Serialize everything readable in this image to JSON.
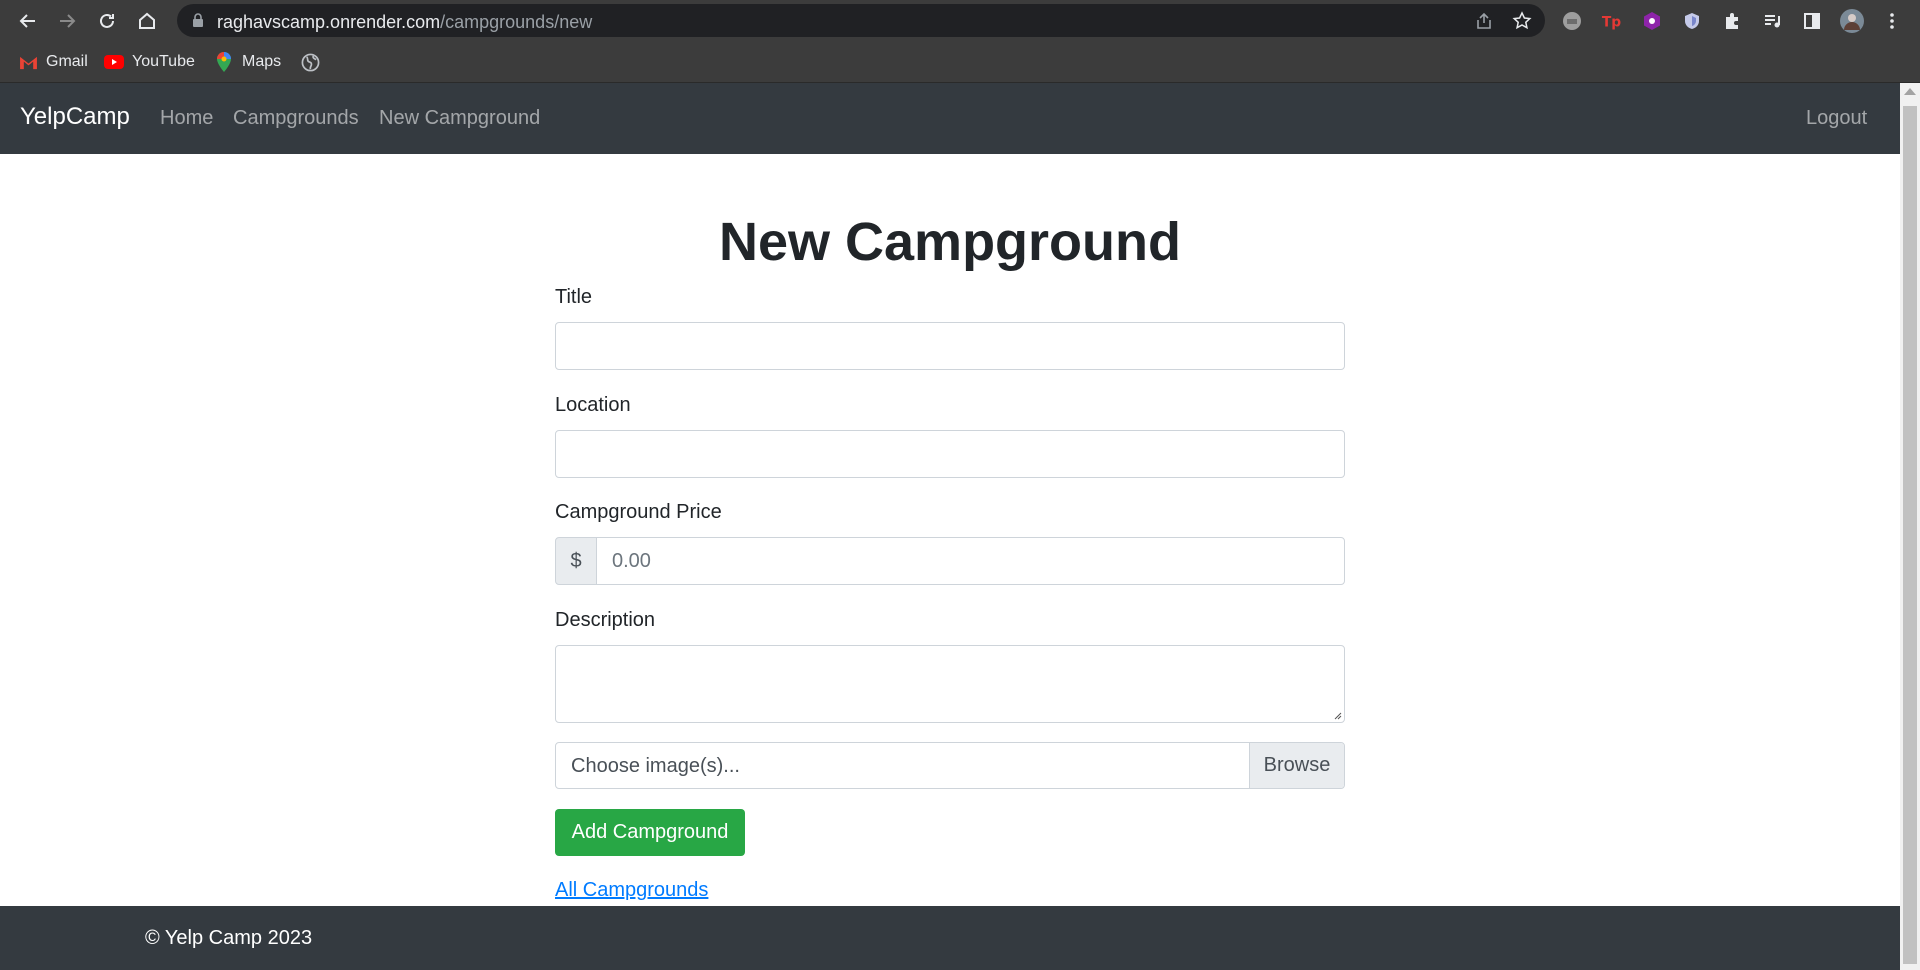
{
  "browser": {
    "url_host": "raghavscamp.onrender.com",
    "url_path": "/campgrounds/new",
    "bookmarks": [
      {
        "label": "Gmail",
        "icon": "gmail-icon"
      },
      {
        "label": "YouTube",
        "icon": "youtube-icon"
      },
      {
        "label": "Maps",
        "icon": "maps-icon"
      },
      {
        "label": "",
        "icon": "globe-icon"
      }
    ]
  },
  "navbar": {
    "brand": "YelpCamp",
    "links": [
      "Home",
      "Campgrounds",
      "New Campground"
    ],
    "logout": "Logout"
  },
  "page": {
    "heading": "New Campground"
  },
  "form": {
    "title_label": "Title",
    "title_value": "",
    "location_label": "Location",
    "location_value": "",
    "price_label": "Campground Price",
    "price_prefix": "$",
    "price_placeholder": "0.00",
    "description_label": "Description",
    "description_value": "",
    "file_placeholder": "Choose image(s)...",
    "browse_label": "Browse",
    "submit_label": "Add Campground",
    "all_link": "All Campgrounds"
  },
  "footer": {
    "text": "© Yelp Camp 2023"
  },
  "colors": {
    "navbar_bg": "#343a40",
    "success": "#28a745",
    "link": "#007bff"
  }
}
